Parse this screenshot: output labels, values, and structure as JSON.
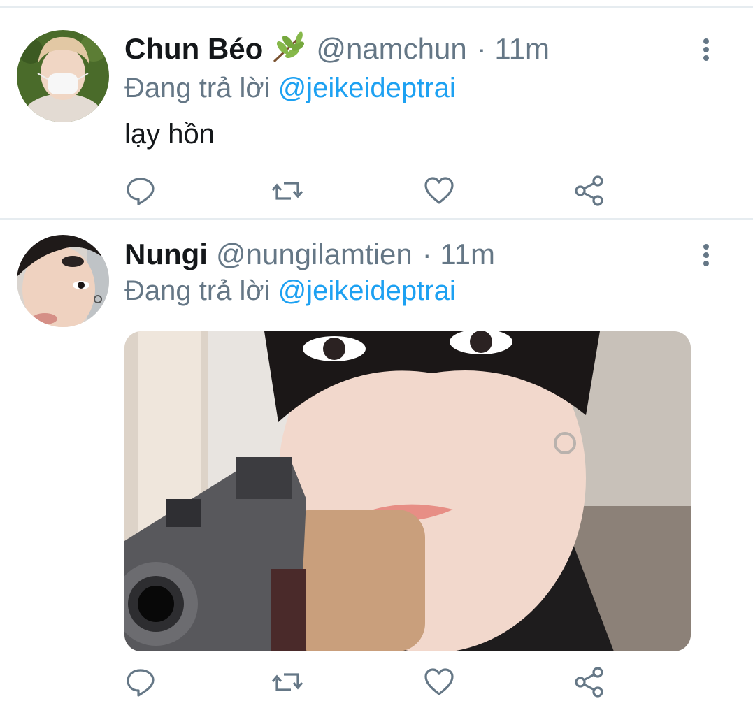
{
  "tweets": [
    {
      "display_name": "Chun Béo",
      "emoji": "🌿",
      "handle": "@namchun",
      "time": "· 11m",
      "reply_prefix": "Đang trả lời",
      "reply_to": "@jeikeideptrai",
      "text": "lạy hồn",
      "icons": [
        "reply-icon",
        "retweet-icon",
        "like-icon",
        "share-icon",
        "more-vertical-icon"
      ]
    },
    {
      "display_name": "Nungi",
      "handle": "@nungilamtien",
      "time": "· 11m",
      "reply_prefix": "Đang trả lời",
      "reply_to": "@jeikeideptrai",
      "media": "photo",
      "icons": [
        "reply-icon",
        "retweet-icon",
        "like-icon",
        "share-icon",
        "more-vertical-icon"
      ]
    }
  ],
  "colors": {
    "text": "#14171a",
    "secondary": "#657786",
    "link": "#1da1f2",
    "divider": "#e6ecf0"
  }
}
